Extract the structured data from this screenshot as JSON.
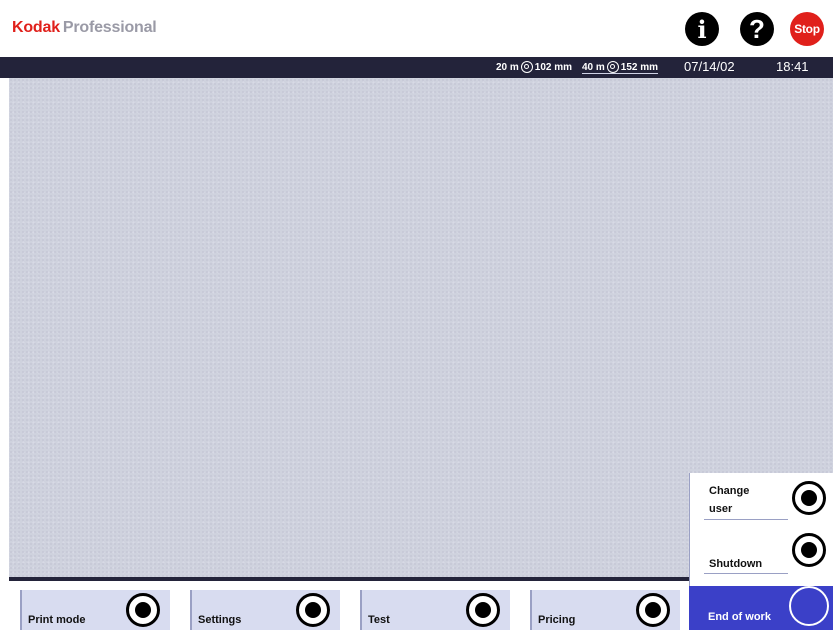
{
  "header": {
    "brand_kodak": "Kodak",
    "brand_professional": "Professional",
    "info_glyph": "i",
    "help_glyph": "?",
    "stop_label": "Stop"
  },
  "status": {
    "roll1_length": "20 m",
    "roll1_width": "102 mm",
    "roll2_length": "40 m",
    "roll2_width": "152 mm",
    "date": "07/14/02",
    "time": "18:41",
    "roll_icon": "paper-roll-icon"
  },
  "bottom_nav": [
    {
      "label": "Print mode"
    },
    {
      "label": "Settings"
    },
    {
      "label": "Test"
    },
    {
      "label": "Pricing"
    }
  ],
  "side_panel": {
    "change_user_line1": "Change",
    "change_user_line2": "user",
    "shutdown_label": "Shutdown",
    "end_of_work_label": "End of work"
  },
  "colors": {
    "brand_red": "#e0201b",
    "bar_dark": "#23233a",
    "workarea": "#cfd2de",
    "button_blue": "#d8dcf0",
    "active_blue": "#3b40c8"
  }
}
